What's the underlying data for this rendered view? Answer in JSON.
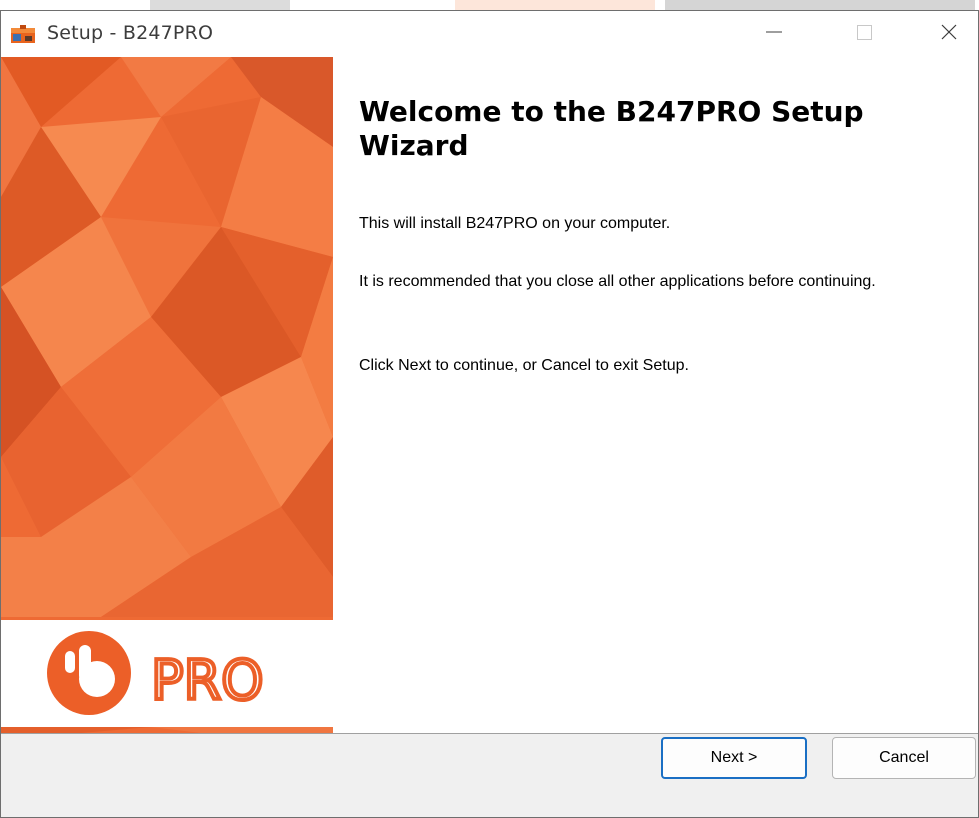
{
  "window": {
    "title": "Setup - B247PRO",
    "icon": "setup-box-icon",
    "controls": [
      "minimize-icon",
      "maximize-icon",
      "close-icon"
    ]
  },
  "banner": {
    "logo_text": "PRO",
    "accent_color": "#ef6a33"
  },
  "main": {
    "heading": "Welcome to the B247PRO Setup Wizard",
    "paragraphs": [
      "This will install B247PRO on your computer.",
      "It is recommended that you close all other applications before continuing.",
      "Click Next to continue, or Cancel to exit Setup."
    ]
  },
  "footer": {
    "next_label": "Next >",
    "cancel_label": "Cancel"
  }
}
